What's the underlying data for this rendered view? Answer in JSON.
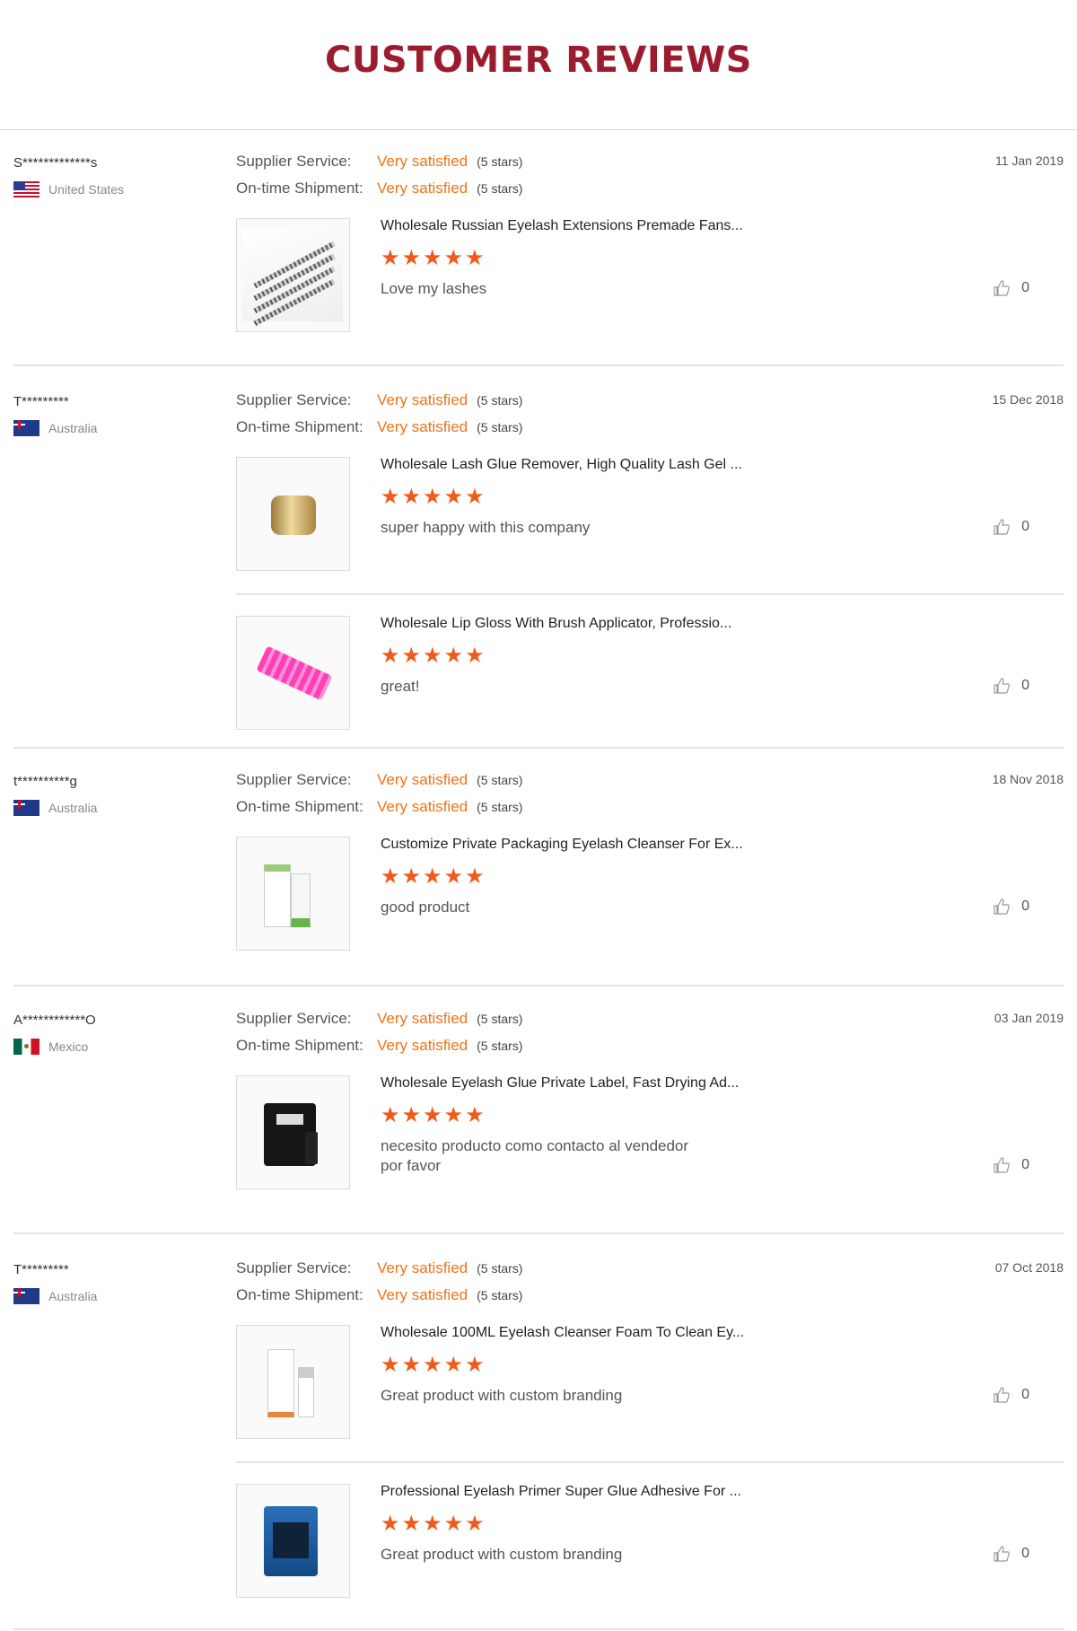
{
  "header": {
    "title": "CUSTOMER REVIEWS"
  },
  "labels": {
    "supplier_service": "Supplier Service:",
    "ontime_shipment": "On-time Shipment:",
    "very_satisfied": "Very satisfied",
    "five_stars": "(5 stars)",
    "stars_glyph": "★★★★★"
  },
  "reviews": [
    {
      "user": "S*************s",
      "country": "United States",
      "flag": "us-flag-icon",
      "date": "11 Jan 2019",
      "items": [
        {
          "product": "Wholesale Russian Eyelash Extensions Premade Fans...",
          "rating": 5,
          "comment": "Love my lashes",
          "likes": "0"
        }
      ]
    },
    {
      "user": "T*********",
      "country": "Australia",
      "flag": "australia-flag-icon",
      "date": "15 Dec 2018",
      "items": [
        {
          "product": "Wholesale Lash Glue Remover, High Quality Lash Gel ...",
          "rating": 5,
          "comment": "super happy with this company",
          "likes": "0"
        },
        {
          "product": "Wholesale Lip Gloss With Brush Applicator, Professio...",
          "rating": 5,
          "comment": "great!",
          "likes": "0"
        }
      ]
    },
    {
      "user": "t**********g",
      "country": "Australia",
      "flag": "australia-flag-icon",
      "date": "18 Nov 2018",
      "items": [
        {
          "product": "Customize Private Packaging Eyelash Cleanser For Ex...",
          "rating": 5,
          "comment": "good product",
          "likes": "0"
        }
      ]
    },
    {
      "user": "A************O",
      "country": "Mexico",
      "flag": "mexico-flag-icon",
      "date": "03 Jan 2019",
      "items": [
        {
          "product": "Wholesale Eyelash Glue Private Label, Fast Drying Ad...",
          "rating": 5,
          "comment_line1": "necesito producto como contacto al vendedor",
          "comment_line2": "por favor",
          "likes": "0"
        }
      ]
    },
    {
      "user": "T*********",
      "country": "Australia",
      "flag": "australia-flag-icon",
      "date": "07 Oct 2018",
      "items": [
        {
          "product": "Wholesale 100ML Eyelash Cleanser Foam To Clean Ey...",
          "rating": 5,
          "comment": "Great product with custom branding",
          "likes": "0"
        },
        {
          "product": "Professional Eyelash Primer Super Glue Adhesive For ...",
          "rating": 5,
          "comment": "Great product with custom branding",
          "likes": "0"
        }
      ]
    }
  ]
}
